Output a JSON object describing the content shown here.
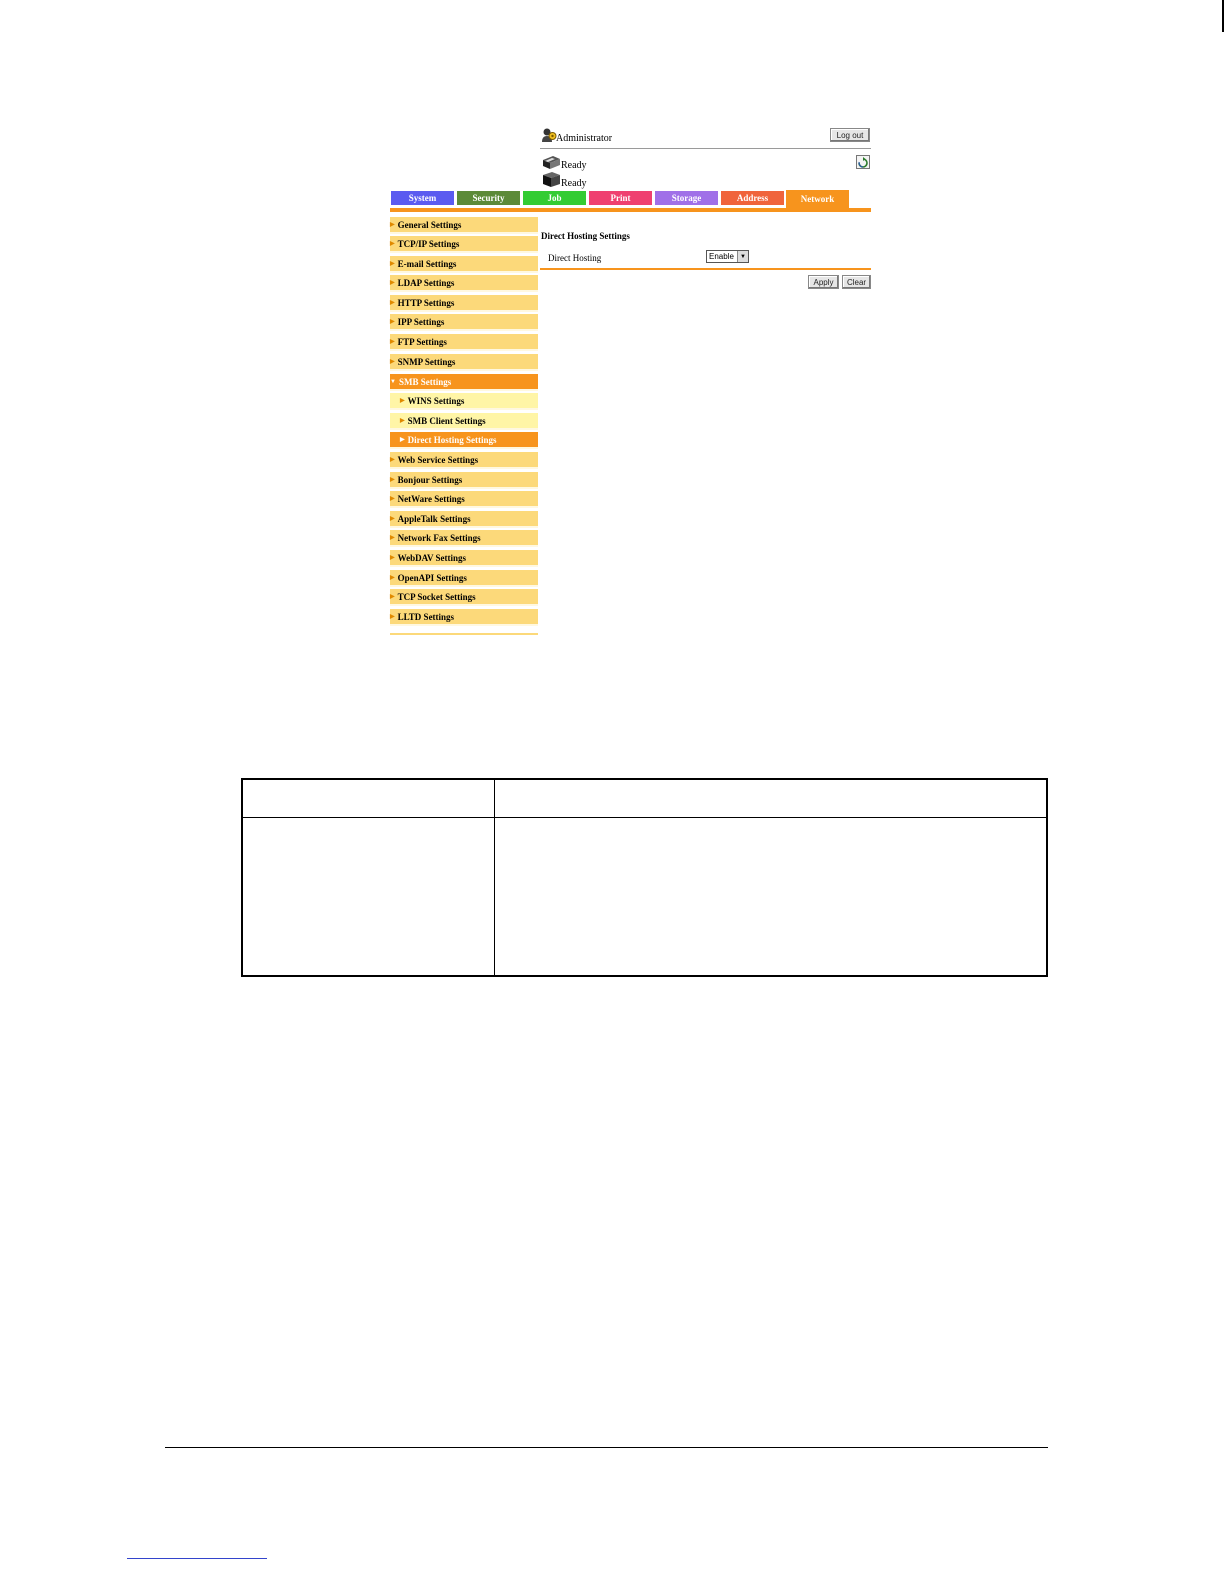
{
  "header": {
    "user_label": "Administrator",
    "logout_label": "Log out",
    "status_printer": "Ready",
    "status_scanner": "Ready"
  },
  "tabs": [
    {
      "label": "System",
      "color": "#5b5bf0"
    },
    {
      "label": "Security",
      "color": "#5c8a38"
    },
    {
      "label": "Job",
      "color": "#33cc33"
    },
    {
      "label": "Print",
      "color": "#ef4070"
    },
    {
      "label": "Storage",
      "color": "#a070e8"
    },
    {
      "label": "Address",
      "color": "#f0643c"
    },
    {
      "label": "Network",
      "color": "#f7941d"
    }
  ],
  "sidebar": {
    "items": [
      {
        "label": "General Settings"
      },
      {
        "label": "TCP/IP Settings"
      },
      {
        "label": "E-mail Settings"
      },
      {
        "label": "LDAP Settings"
      },
      {
        "label": "HTTP Settings"
      },
      {
        "label": "IPP Settings"
      },
      {
        "label": "FTP Settings"
      },
      {
        "label": "SNMP Settings"
      },
      {
        "label": "SMB Settings"
      },
      {
        "label": "WINS Settings"
      },
      {
        "label": "SMB Client Settings"
      },
      {
        "label": "Direct Hosting Settings"
      },
      {
        "label": "Web Service Settings"
      },
      {
        "label": "Bonjour Settings"
      },
      {
        "label": "NetWare Settings"
      },
      {
        "label": "AppleTalk Settings"
      },
      {
        "label": "Network Fax Settings"
      },
      {
        "label": "WebDAV Settings"
      },
      {
        "label": "OpenAPI Settings"
      },
      {
        "label": "TCP Socket Settings"
      },
      {
        "label": "LLTD Settings"
      }
    ]
  },
  "content": {
    "title": "Direct Hosting Settings",
    "row_label": "Direct Hosting",
    "row_value": "Enable",
    "apply_label": "Apply",
    "clear_label": "Clear"
  },
  "colors": {
    "accent": "#f7941d",
    "menu_item": "#fcd97a",
    "submenu_item": "#fff5a6",
    "selected_item": "#f7941d"
  }
}
